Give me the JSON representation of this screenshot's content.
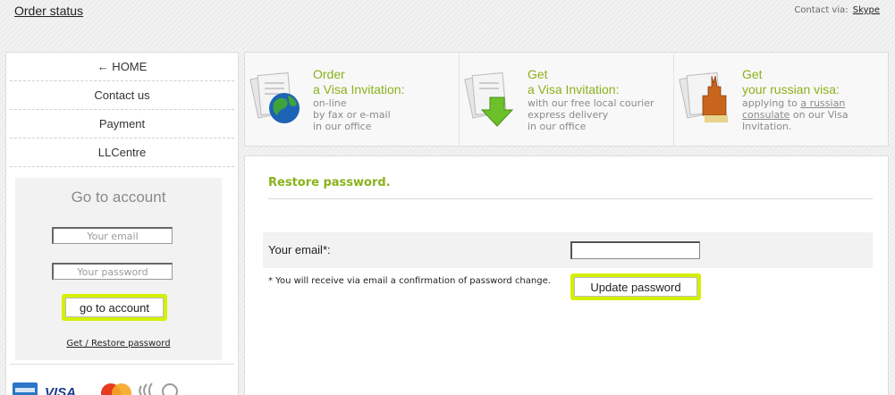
{
  "header": {
    "order_status": "Order status",
    "contact_label": "Contact via:",
    "contact_link": "Skype"
  },
  "sidebar": {
    "nav": [
      {
        "label": "← HOME"
      },
      {
        "label": "Contact us"
      },
      {
        "label": "Payment"
      },
      {
        "label": "LLCentre"
      }
    ],
    "account": {
      "title": "Go to account",
      "email_placeholder": "Your email",
      "password_placeholder": "Your password",
      "button_label": "go to account",
      "restore_link": "Get / Restore password"
    },
    "payment_icons": [
      "amex-card-icon",
      "visa-card-icon",
      "mastercard-icon",
      "paypass-icon"
    ]
  },
  "info_panels": [
    {
      "icon": "globe-documents-icon",
      "title": "Order",
      "subtitle": "a Visa Invitation:",
      "lines": [
        "on-line",
        "by fax or e-mail",
        "in our office"
      ]
    },
    {
      "icon": "download-documents-icon",
      "title": "Get",
      "subtitle": "a Visa Invitation:",
      "lines": [
        "with our free local courier",
        "express delivery",
        "in our office"
      ]
    },
    {
      "icon": "kremlin-documents-icon",
      "title": "Get",
      "subtitle": "your russian visa:",
      "line1_prefix": "applying to ",
      "line1_link": "a russian",
      "line2_link": "consulate",
      "line2_suffix": " on our Visa",
      "line3": "Invitation."
    }
  ],
  "main": {
    "title": "Restore password.",
    "email_label": "Your email*:",
    "email_value": "",
    "note": "* You will receive via email a confirmation of password change.",
    "update_button": "Update password"
  },
  "colors": {
    "accent_green": "#8ab21b",
    "button_highlight": "#d4f000"
  }
}
